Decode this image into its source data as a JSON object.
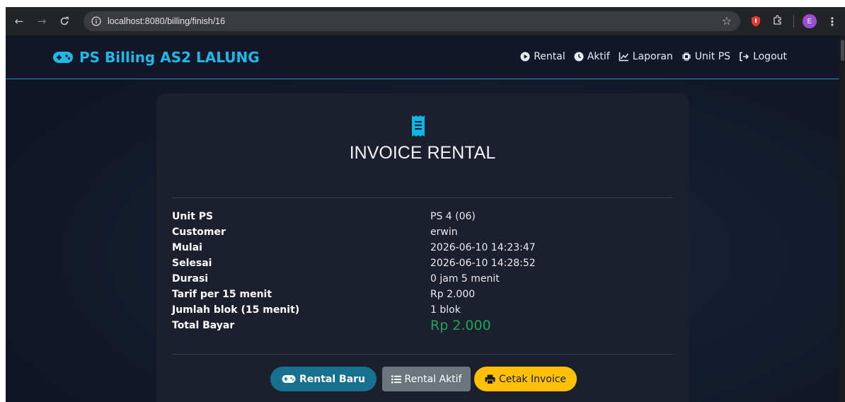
{
  "browser": {
    "url": "localhost:8080/billing/finish/16",
    "profile_initial": "E"
  },
  "navbar": {
    "brand": "PS Billing AS2 LALUNG",
    "menu": [
      {
        "label": "Rental",
        "icon": "play-circle-icon"
      },
      {
        "label": "Aktif",
        "icon": "clock-icon"
      },
      {
        "label": "Laporan",
        "icon": "chart-line-icon"
      },
      {
        "label": "Unit PS",
        "icon": "chip-icon"
      },
      {
        "label": "Logout",
        "icon": "logout-icon"
      }
    ]
  },
  "invoice": {
    "title": "INVOICE RENTAL",
    "icon": "receipt-icon",
    "rows": [
      {
        "label": "Unit PS",
        "value": "PS 4 (06)"
      },
      {
        "label": "Customer",
        "value": "erwin"
      },
      {
        "label": "Mulai",
        "value": "2026-06-10 14:23:47"
      },
      {
        "label": "Selesai",
        "value": "2026-06-10 14:28:52"
      },
      {
        "label": "Durasi",
        "value": "0 jam 5 menit"
      },
      {
        "label": "Tarif per 15 menit",
        "value": "Rp 2.000"
      },
      {
        "label": "Jumlah blok (15 menit)",
        "value": "1 blok"
      },
      {
        "label": "Total Bayar",
        "value": "Rp 2.000"
      }
    ]
  },
  "actions": {
    "rental_baru": "Rental Baru",
    "rental_aktif": "Rental Aktif",
    "cetak_invoice": "Cetak Invoice"
  },
  "colors": {
    "brand": "#22b8e6",
    "total": "#1fa35a",
    "btn_primary": "#17718e",
    "btn_secondary": "#6c757d",
    "btn_warning": "#ffc107"
  }
}
